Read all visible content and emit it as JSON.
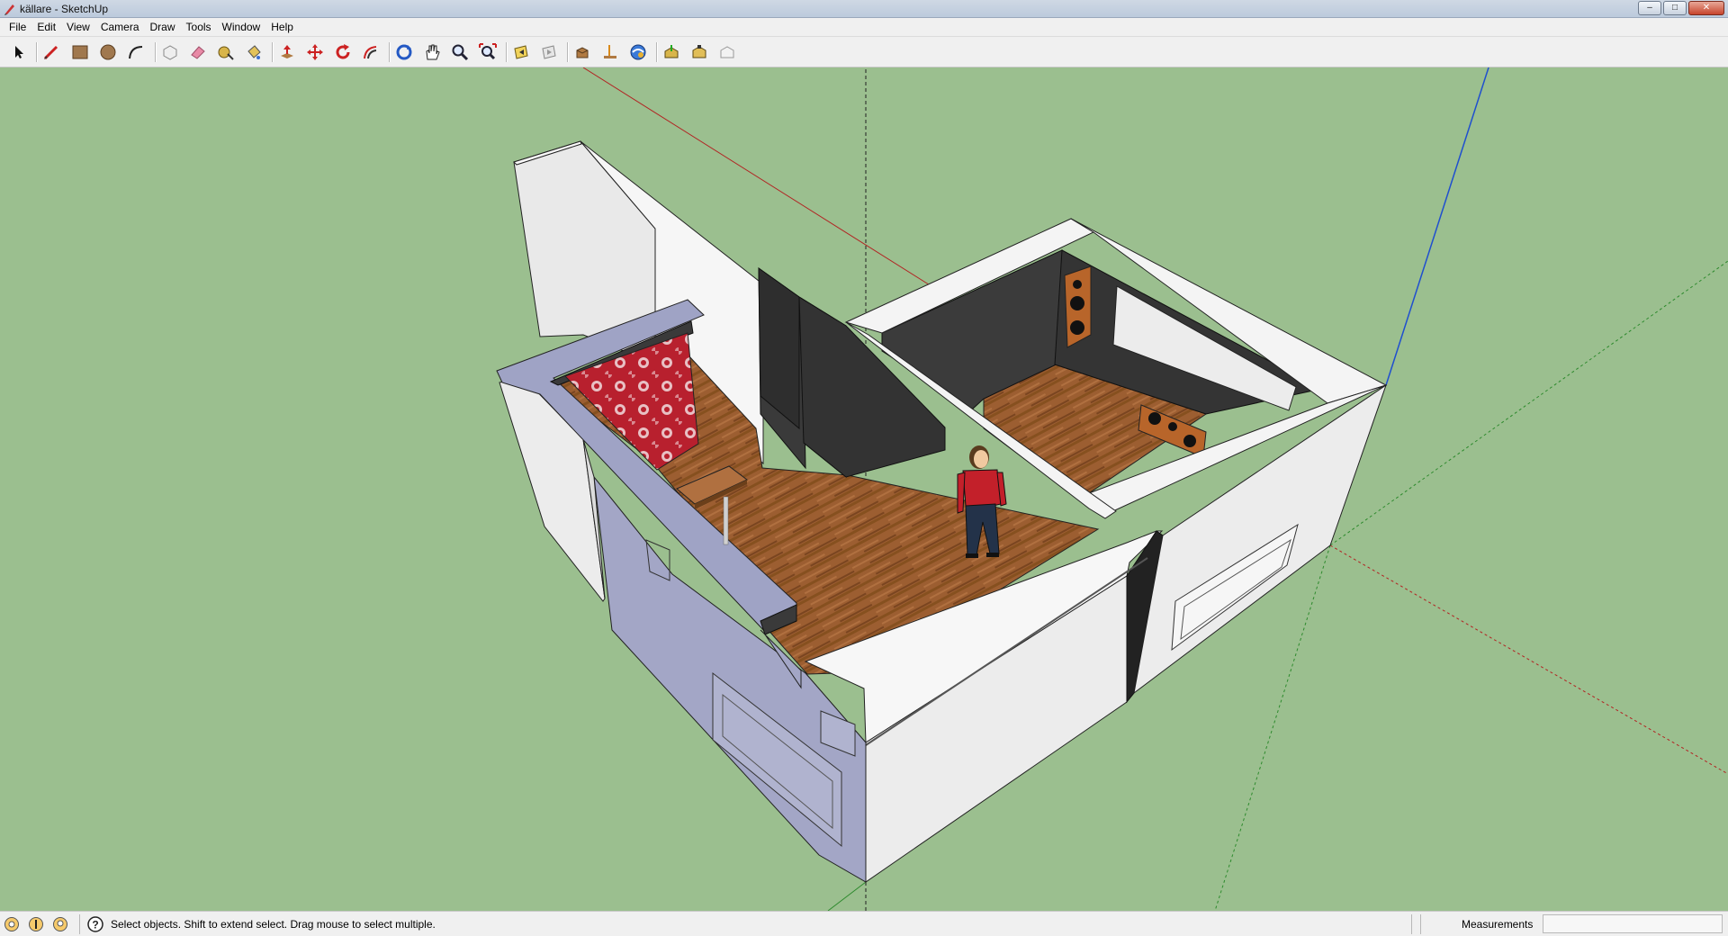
{
  "window": {
    "title": "källare - SketchUp",
    "controls": {
      "minimize": "–",
      "maximize": "□",
      "close": "✕"
    }
  },
  "menu": [
    "File",
    "Edit",
    "View",
    "Camera",
    "Draw",
    "Tools",
    "Window",
    "Help"
  ],
  "toolbar": {
    "tools": [
      "select-tool",
      "line-tool",
      "rectangle-tool",
      "circle-tool",
      "arc-tool",
      "make-component-tool",
      "eraser-tool",
      "tape-measure-tool",
      "paint-bucket-tool",
      "push-pull-tool",
      "move-tool",
      "rotate-tool",
      "offset-tool",
      "orbit-tool",
      "pan-tool",
      "zoom-tool",
      "zoom-extents-tool",
      "previous-view-tool",
      "next-view-tool",
      "top-view-tool",
      "iso-view-tool",
      "get-models-tool",
      "share-model-tool",
      "components-tool",
      "share-component-tool"
    ]
  },
  "status": {
    "hint": "Select objects. Shift to extend select. Drag mouse to select multiple.",
    "measurements_label": "Measurements",
    "measurements_value": ""
  },
  "colors": {
    "ground": "#9bbf8f",
    "wall_white": "#f4f4f4",
    "wall_shade": "#dcdcdc",
    "wall_blue": "#a3a6c6",
    "wall_dark": "#3a3a3a",
    "floor_wood": "#9c5e31",
    "wallpaper_red": "#b8202e",
    "axis_red": "#b22222",
    "axis_blue": "#1f4fcf",
    "axis_green": "#2d8a2d"
  }
}
